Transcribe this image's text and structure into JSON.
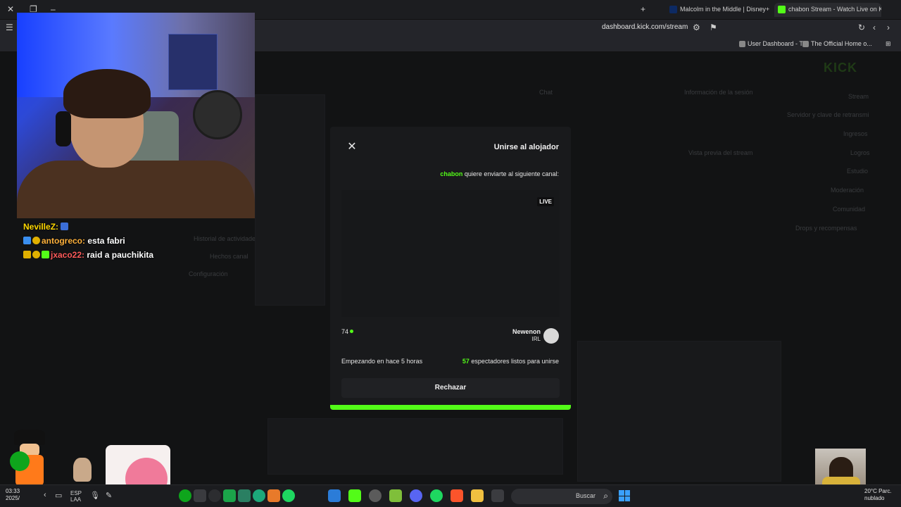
{
  "browser": {
    "tabs": [
      {
        "label": "chabon Stream - Watch Live on K",
        "active": true
      },
      {
        "label": "Malcolm in the Middle | Disney+",
        "active": false
      }
    ],
    "url": "dashboard.kick.com/stream",
    "bookmarks": [
      "User Dashboard - T...",
      "The Official Home o..."
    ]
  },
  "dashboard": {
    "logo": "KICK",
    "sidebar": [
      "Stream",
      "Servidor y clave de retransmi",
      "Ingresos",
      "Logros",
      "Estudio",
      "Moderación",
      "Comunidad",
      "Drops y recompensas"
    ],
    "panel_labels": [
      "Información de la sesión",
      "Vista previa del stream",
      "Chat"
    ],
    "left_panel": [
      "Historial de actividades",
      "Hechos canal",
      "Configuración"
    ]
  },
  "chat": {
    "messages": [
      {
        "user": "NevilleZ",
        "text": ""
      },
      {
        "user": "antogreco",
        "text": "esta fabri"
      },
      {
        "user": "jxaco22",
        "text": "raid a pauchikita"
      }
    ]
  },
  "modal": {
    "title": "Unirse al alojador",
    "channel": "chabon",
    "subtitle_rest": "quiere enviarte al siguiente canal:",
    "live_badge": "LIVE",
    "viewer_count": "74",
    "target_name": "Newenon",
    "target_category": "IRL",
    "ready_count": "57",
    "ready_text": "espectadores listos para unirse",
    "start_text": "Empezando en hace 5 horas",
    "reject_label": "Rechazar",
    "progress": 1.0,
    "accent_color": "#53fc18"
  },
  "taskbar": {
    "time": "03:33",
    "date": "2025/",
    "lang": "ESP LAA",
    "search_placeholder": "Buscar",
    "weather": "20°C Parc. nublado"
  }
}
